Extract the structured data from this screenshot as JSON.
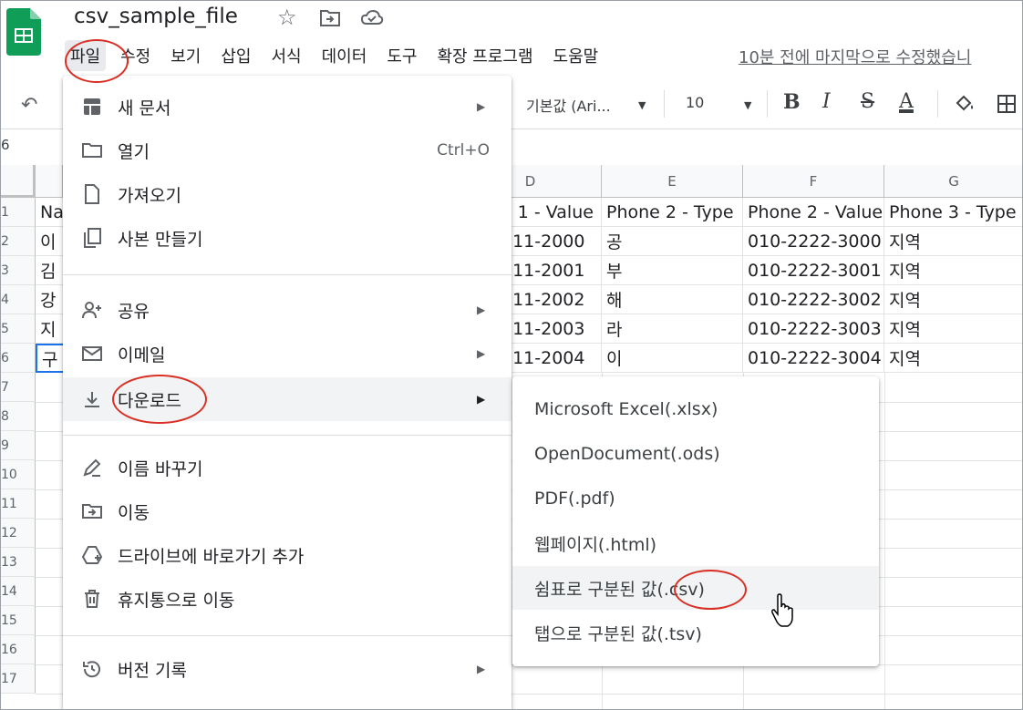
{
  "app": {
    "title": "csv_sample_file",
    "last_edit": "10분 전에 마지막으로 수정했습니",
    "icons": [
      "sheets-logo-icon",
      "star-icon",
      "move-to-folder-icon",
      "cloud-status-icon"
    ]
  },
  "menubar": {
    "items": [
      "파일",
      "수정",
      "보기",
      "삽입",
      "서식",
      "데이터",
      "도구",
      "확장 프로그램",
      "도움말"
    ]
  },
  "toolbar": {
    "undo_icon": "undo-icon",
    "font_family": "기본값 (Ari...",
    "font_size": "10",
    "bold": "B",
    "italic": "I",
    "strike": "S",
    "text_color": "A",
    "text_color_value": "#000000"
  },
  "formula_bar": {
    "cell_ref": "6"
  },
  "grid": {
    "columns": [
      "D",
      "E",
      "F",
      "G"
    ],
    "rows": [
      "1",
      "2",
      "3",
      "4",
      "5",
      "6",
      "7",
      "8",
      "9",
      "10",
      "11",
      "12",
      "13",
      "14",
      "15",
      "16",
      "17"
    ],
    "col_b_partial": [
      "Na",
      "이",
      "김",
      "강",
      "지",
      "구"
    ],
    "cells": [
      [
        "e 1 - Value",
        "Phone 2 - Type",
        "Phone 2 - Value",
        "Phone 3 - Type"
      ],
      [
        "111-2000",
        "공",
        "010-2222-3000",
        "지역"
      ],
      [
        "111-2001",
        "부",
        "010-2222-3001",
        "지역"
      ],
      [
        "111-2002",
        "해",
        "010-2222-3002",
        "지역"
      ],
      [
        "111-2003",
        "라",
        "010-2222-3003",
        "지역"
      ],
      [
        "111-2004",
        "이",
        "010-2222-3004",
        "지역"
      ]
    ]
  },
  "file_menu": {
    "items": [
      {
        "label": "새 문서",
        "icon": "new-document-icon",
        "submenu": true
      },
      {
        "label": "열기",
        "icon": "folder-open-icon",
        "shortcut": "Ctrl+O"
      },
      {
        "label": "가져오기",
        "icon": "import-file-icon"
      },
      {
        "label": "사본 만들기",
        "icon": "copy-icon"
      },
      {
        "label": "공유",
        "icon": "share-person-icon",
        "submenu": true
      },
      {
        "label": "이메일",
        "icon": "email-icon",
        "submenu": true
      },
      {
        "label": "다운로드",
        "icon": "download-icon",
        "submenu": true,
        "highlighted": true
      },
      {
        "label": "이름 바꾸기",
        "icon": "rename-icon"
      },
      {
        "label": "이동",
        "icon": "move-folder-icon"
      },
      {
        "label": "드라이브에 바로가기 추가",
        "icon": "drive-shortcut-icon"
      },
      {
        "label": "휴지통으로 이동",
        "icon": "trash-icon"
      },
      {
        "label": "버전 기록",
        "icon": "history-icon",
        "submenu": true
      }
    ]
  },
  "download_submenu": {
    "items": [
      "Microsoft Excel(.xlsx)",
      "OpenDocument(.ods)",
      "PDF(.pdf)",
      "웹페이지(.html)",
      "쉼표로 구분된 값(.csv)",
      "탭으로 구분된 값(.tsv)"
    ],
    "hovered_index": 4
  },
  "annotation_color": "#d93025"
}
